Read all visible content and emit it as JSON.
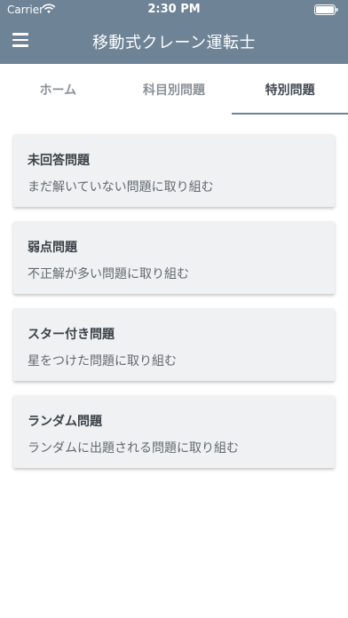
{
  "status_bar": {
    "carrier": "Carrier",
    "time": "2:30 PM"
  },
  "header": {
    "title": "移動式クレーン運転士",
    "menu_icon": "hamburger-menu-icon"
  },
  "tabs": [
    {
      "label": "ホーム",
      "active": false
    },
    {
      "label": "科目別問題",
      "active": false
    },
    {
      "label": "特別問題",
      "active": true
    }
  ],
  "cards": [
    {
      "title": "未回答問題",
      "description": "まだ解いていない問題に取り組む"
    },
    {
      "title": "弱点問題",
      "description": "不正解が多い問題に取り組む"
    },
    {
      "title": "スター付き問題",
      "description": "星をつけた問題に取り組む"
    },
    {
      "title": "ランダム問題",
      "description": "ランダムに出題される問題に取り組む"
    }
  ],
  "colors": {
    "header_bg": "#6e8396",
    "card_bg": "#eff1f3",
    "active_tab_underline": "#6e8396"
  }
}
